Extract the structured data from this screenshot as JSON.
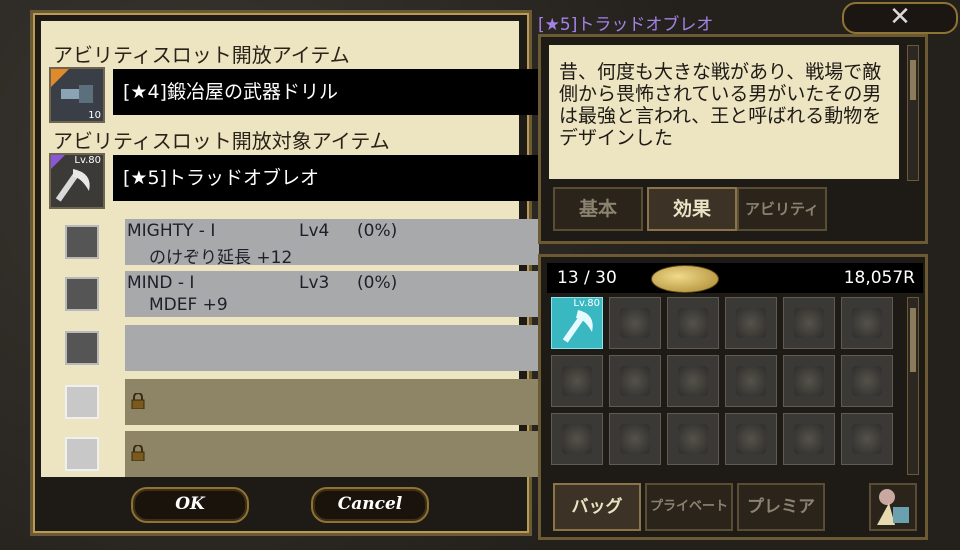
{
  "left": {
    "section1_title": "アビリティスロット開放アイテム",
    "item1": {
      "name": "[★4]鍛冶屋の武器ドリル",
      "count": "10"
    },
    "section2_title": "アビリティスロット開放対象アイテム",
    "item2": {
      "name": "[★5]トラッドオブレオ",
      "level": "Lv.80"
    },
    "slots": [
      {
        "name": "MIGHTY - I",
        "lv": "Lv4",
        "pct": "(0%)",
        "effect": "のけぞり延長 +12",
        "locked": false
      },
      {
        "name": "MIND - I",
        "lv": "Lv3",
        "pct": "(0%)",
        "effect": "MDEF +9",
        "locked": false
      },
      {
        "name": "",
        "lv": "",
        "pct": "",
        "effect": "",
        "locked": false
      },
      {
        "name": "",
        "lv": "",
        "pct": "",
        "effect": "",
        "locked": true
      },
      {
        "name": "",
        "lv": "",
        "pct": "",
        "effect": "",
        "locked": true
      }
    ],
    "ok_label": "OK",
    "cancel_label": "Cancel"
  },
  "right": {
    "title": "[★5]トラッドオブレオ",
    "close_label": "✕",
    "description": "昔、何度も大きな戦があり、戦場で敵側から畏怖されている男がいたその男は最強と言われ、王と呼ばれる動物をデザインした",
    "tabs": [
      "基本",
      "効果",
      "アビリティ"
    ],
    "active_tab": 1
  },
  "inventory": {
    "count": "13 / 30",
    "money": "18,057R",
    "selected_level": "Lv.80",
    "bottom_tabs": [
      "バッグ",
      "プライベート",
      "プレミア"
    ],
    "active_bottom_tab": 0
  }
}
